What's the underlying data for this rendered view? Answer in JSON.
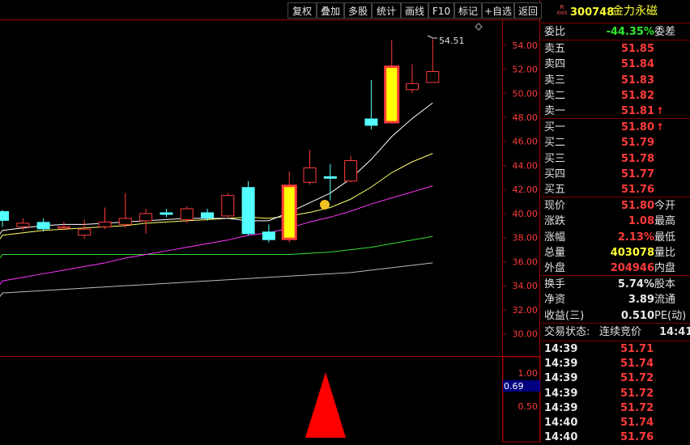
{
  "toolbar": {
    "buttons": [
      "复权",
      "叠加",
      "多股",
      "统计",
      "画线",
      "F10",
      "标记",
      "+自选",
      "返回"
    ]
  },
  "stock": {
    "badge_top": "R",
    "badge_bottom": "I000",
    "code": "300748",
    "name": "金力永磁"
  },
  "chart_data": {
    "type": "candlestick",
    "y_axis_labels": [
      "54.00",
      "52.00",
      "50.00",
      "48.00",
      "46.00",
      "44.00",
      "42.00",
      "40.00",
      "38.00",
      "36.00",
      "34.00",
      "32.00",
      "30.00"
    ],
    "ylim": [
      28.7,
      55.8
    ],
    "max_label": "54.51",
    "indicator_axis_labels": [
      "1.00",
      "0.50"
    ],
    "indicator_value": "0.69",
    "candles": [
      {
        "o": 39.4,
        "c": 40.2,
        "h": 40.3,
        "l": 38.9,
        "color": "cyan"
      },
      {
        "o": 38.9,
        "c": 39.2,
        "h": 39.6,
        "l": 38.6,
        "color": "red"
      },
      {
        "o": 39.3,
        "c": 38.7,
        "h": 39.6,
        "l": 38.5,
        "color": "cyan"
      },
      {
        "o": 38.8,
        "c": 38.9,
        "h": 39.3,
        "l": 38.6,
        "color": "red"
      },
      {
        "o": 38.2,
        "c": 38.7,
        "h": 39.5,
        "l": 37.9,
        "color": "red"
      },
      {
        "o": 38.9,
        "c": 39.3,
        "h": 40.5,
        "l": 38.7,
        "color": "red"
      },
      {
        "o": 39.1,
        "c": 39.6,
        "h": 41.7,
        "l": 38.8,
        "color": "red"
      },
      {
        "o": 39.4,
        "c": 40.0,
        "h": 40.4,
        "l": 38.3,
        "color": "red"
      },
      {
        "o": 39.9,
        "c": 40.1,
        "h": 40.4,
        "l": 39.7,
        "color": "cyan"
      },
      {
        "o": 39.5,
        "c": 40.4,
        "h": 40.6,
        "l": 39.2,
        "color": "red"
      },
      {
        "o": 40.1,
        "c": 39.6,
        "h": 40.4,
        "l": 39.4,
        "color": "cyan"
      },
      {
        "o": 39.8,
        "c": 41.5,
        "h": 41.7,
        "l": 39.7,
        "color": "red"
      },
      {
        "o": 42.2,
        "c": 38.3,
        "h": 42.7,
        "l": 38.2,
        "color": "cyan"
      },
      {
        "o": 38.5,
        "c": 37.8,
        "h": 39.1,
        "l": 37.6,
        "color": "cyan"
      },
      {
        "o": 37.9,
        "c": 42.3,
        "h": 43.5,
        "l": 37.6,
        "color": "limit"
      },
      {
        "o": 42.6,
        "c": 43.8,
        "h": 45.3,
        "l": 42.4,
        "color": "red"
      },
      {
        "o": 43.1,
        "c": 42.9,
        "h": 44.1,
        "l": 41.1,
        "color": "cyan"
      },
      {
        "o": 42.7,
        "c": 44.4,
        "h": 44.8,
        "l": 42.6,
        "color": "red"
      },
      {
        "o": 47.9,
        "c": 47.3,
        "h": 51.1,
        "l": 47.0,
        "color": "cyan"
      },
      {
        "o": 47.6,
        "c": 52.2,
        "h": 54.4,
        "l": 47.6,
        "color": "limit"
      },
      {
        "o": 50.3,
        "c": 50.8,
        "h": 52.4,
        "l": 50.0,
        "color": "red"
      },
      {
        "o": 50.9,
        "c": 51.8,
        "h": 54.5,
        "l": 50.9,
        "color": "red"
      }
    ],
    "ma_white": [
      38.6,
      38.8,
      39.0,
      39.1,
      39.1,
      39.2,
      39.3,
      39.4,
      39.5,
      39.6,
      39.6,
      39.6,
      39.4,
      39.4,
      40.1,
      40.9,
      41.7,
      42.9,
      44.5,
      46.4,
      47.9,
      49.2
    ],
    "ma_yellow": [
      38.2,
      38.4,
      38.6,
      38.7,
      38.8,
      38.9,
      39.0,
      39.2,
      39.3,
      39.4,
      39.5,
      39.6,
      39.7,
      39.6,
      39.8,
      40.1,
      40.5,
      41.2,
      42.2,
      43.4,
      44.3,
      45.0
    ],
    "ma_magenta": [
      34.4,
      34.7,
      35.0,
      35.3,
      35.6,
      35.9,
      36.3,
      36.6,
      36.9,
      37.2,
      37.5,
      37.8,
      38.2,
      38.4,
      38.8,
      39.3,
      39.7,
      40.2,
      40.8,
      41.3,
      41.8,
      42.3
    ],
    "ma_green": [
      36.6,
      36.6,
      36.6,
      36.6,
      36.6,
      36.6,
      36.6,
      36.6,
      36.6,
      36.6,
      36.6,
      36.6,
      36.6,
      36.6,
      36.6,
      36.7,
      36.8,
      37.0,
      37.2,
      37.5,
      37.8,
      38.1
    ],
    "ma_gray": [
      33.4,
      33.5,
      33.6,
      33.7,
      33.8,
      33.9,
      34.0,
      34.1,
      34.2,
      34.3,
      34.4,
      34.5,
      34.6,
      34.7,
      34.8,
      34.9,
      35.0,
      35.1,
      35.3,
      35.5,
      35.7,
      35.9
    ]
  },
  "quote": {
    "weibi_label": "委比",
    "weibi_value": "-44.35%",
    "weicha_label": "委差",
    "asks": [
      {
        "label": "卖五",
        "price": "51.85",
        "arrow": ""
      },
      {
        "label": "卖四",
        "price": "51.84",
        "arrow": ""
      },
      {
        "label": "卖三",
        "price": "51.83",
        "arrow": ""
      },
      {
        "label": "卖二",
        "price": "51.82",
        "arrow": ""
      },
      {
        "label": "卖一",
        "price": "51.81",
        "arrow": "↑"
      }
    ],
    "bids": [
      {
        "label": "买一",
        "price": "51.80",
        "arrow": "↑"
      },
      {
        "label": "买二",
        "price": "51.79",
        "arrow": ""
      },
      {
        "label": "买三",
        "price": "51.78",
        "arrow": ""
      },
      {
        "label": "买四",
        "price": "51.77",
        "arrow": ""
      },
      {
        "label": "买五",
        "price": "51.76",
        "arrow": ""
      }
    ],
    "stats": [
      {
        "label": "现价",
        "value": "51.80",
        "suffix": "今开",
        "color": "red"
      },
      {
        "label": "涨跌",
        "value": "1.08",
        "suffix": "最高",
        "color": "red"
      },
      {
        "label": "涨幅",
        "value": "2.13%",
        "suffix": "最低",
        "color": "red"
      },
      {
        "label": "总量",
        "value": "403078",
        "suffix": "量比",
        "color": "yellow"
      },
      {
        "label": "外盘",
        "value": "204946",
        "suffix": "内盘",
        "color": "red"
      }
    ],
    "stats2": [
      {
        "label": "换手",
        "value": "5.74%",
        "suffix": "股本"
      },
      {
        "label": "净资",
        "value": "3.89",
        "suffix": "流通"
      },
      {
        "label": "收益(三)",
        "value": "0.510",
        "suffix": "PE(动)"
      }
    ],
    "status_label": "交易状态:",
    "status_value": "连续竞价",
    "status_time": "14:41:"
  },
  "ticks": [
    {
      "time": "14:39",
      "price": "51.71"
    },
    {
      "time": "14:39",
      "price": "51.74"
    },
    {
      "time": "14:39",
      "price": "51.72"
    },
    {
      "time": "14:39",
      "price": "51.72"
    },
    {
      "time": "14:39",
      "price": "51.72"
    },
    {
      "time": "14:40",
      "price": "51.74"
    },
    {
      "time": "14:40",
      "price": "51.76"
    }
  ],
  "colors": {
    "rise": "#ff3b3b",
    "fall": "#54ffff",
    "limit_fill": "#ffff00",
    "ma_white": "#ffffff",
    "ma_yellow": "#ffff66",
    "ma_magenta": "#ff33ff",
    "ma_green": "#33dd33",
    "ma_gray": "#bbbbbb",
    "border": "#a00000"
  }
}
